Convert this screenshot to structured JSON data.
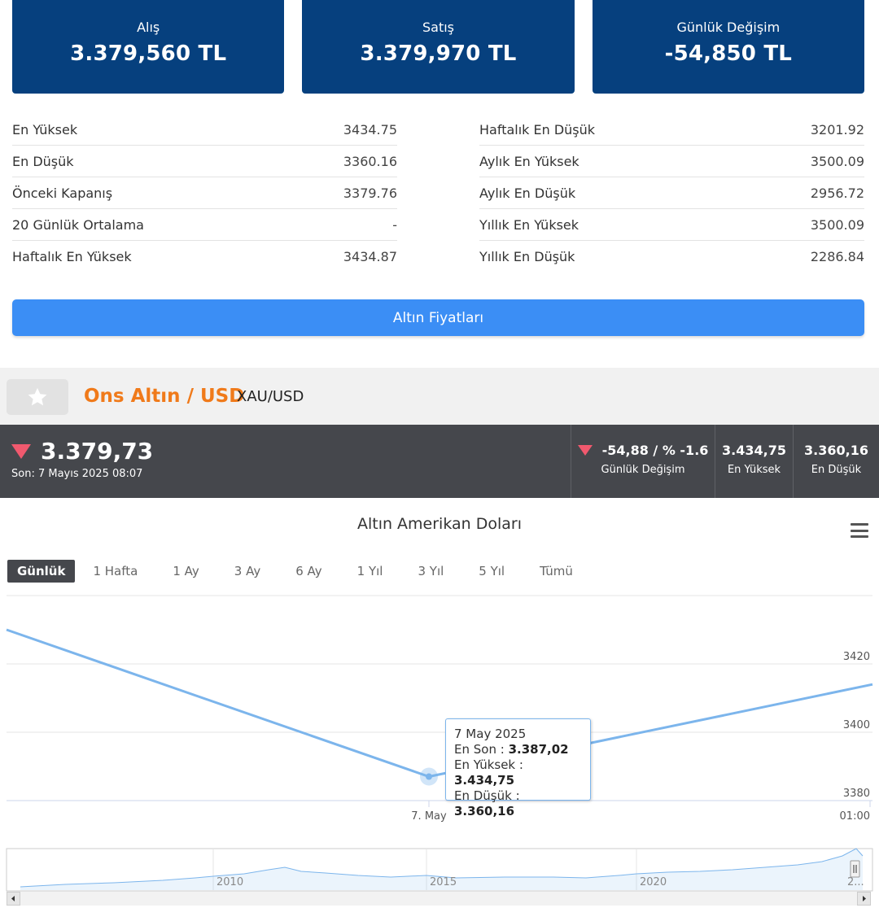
{
  "cards": [
    {
      "label": "Alış",
      "value": "3.379,560 TL"
    },
    {
      "label": "Satış",
      "value": "3.379,970 TL"
    },
    {
      "label": "Günlük Değişim",
      "value": "-54,850 TL"
    }
  ],
  "stats_left": [
    {
      "label": "En Yüksek",
      "value": "3434.75"
    },
    {
      "label": "En Düşük",
      "value": "3360.16"
    },
    {
      "label": "Önceki Kapanış",
      "value": "3379.76"
    },
    {
      "label": "20 Günlük Ortalama",
      "value": "-"
    },
    {
      "label": "Haftalık En Yüksek",
      "value": "3434.87"
    }
  ],
  "stats_right": [
    {
      "label": "Haftalık En Düşük",
      "value": "3201.92"
    },
    {
      "label": "Aylık En Yüksek",
      "value": "3500.09"
    },
    {
      "label": "Aylık En Düşük",
      "value": "2956.72"
    },
    {
      "label": "Yıllık En Yüksek",
      "value": "3500.09"
    },
    {
      "label": "Yıllık En Düşük",
      "value": "2286.84"
    }
  ],
  "gold_button": "Altın Fiyatları",
  "instrument": {
    "name": "Ons Altın / USD",
    "symbol": "XAU/USD",
    "favorite_icon": "star-icon"
  },
  "price_bar": {
    "price": "3.379,73",
    "last_update": "Son: 7 Mayıs 2025 08:07",
    "change_value": "-54,88 / % -1.6",
    "change_label": "Günlük Değişim",
    "high_value": "3.434,75",
    "high_label": "En Yüksek",
    "low_value": "3.360,16",
    "low_label": "En Düşük",
    "down_color": "#f0596e"
  },
  "chart": {
    "title": "Altın Amerikan Doları",
    "ranges": [
      "Günlük",
      "1 Hafta",
      "1 Ay",
      "3 Ay",
      "6 Ay",
      "1 Yıl",
      "3 Yıl",
      "5 Yıl",
      "Tümü"
    ],
    "active_range": "Günlük",
    "tooltip": {
      "date": "7 May 2025",
      "close_label": "En Son : ",
      "close_value": "3.387,02",
      "high_label": "En Yüksek : ",
      "high_value": "3.434,75",
      "low_label": "En Düşük : ",
      "low_value": "3.360,16"
    }
  },
  "chart_data": {
    "type": "line",
    "x_labels": [
      "7. May",
      "01:00"
    ],
    "y_ticks": [
      3380,
      3400,
      3420
    ],
    "ylim": [
      3380,
      3420
    ],
    "series": [
      {
        "values": [
          3430,
          3387.02,
          3414
        ]
      }
    ],
    "navigator_labels": [
      "2010",
      "2015",
      "2020",
      "2..."
    ],
    "line_color": "#7cb5ec",
    "grid": true
  }
}
